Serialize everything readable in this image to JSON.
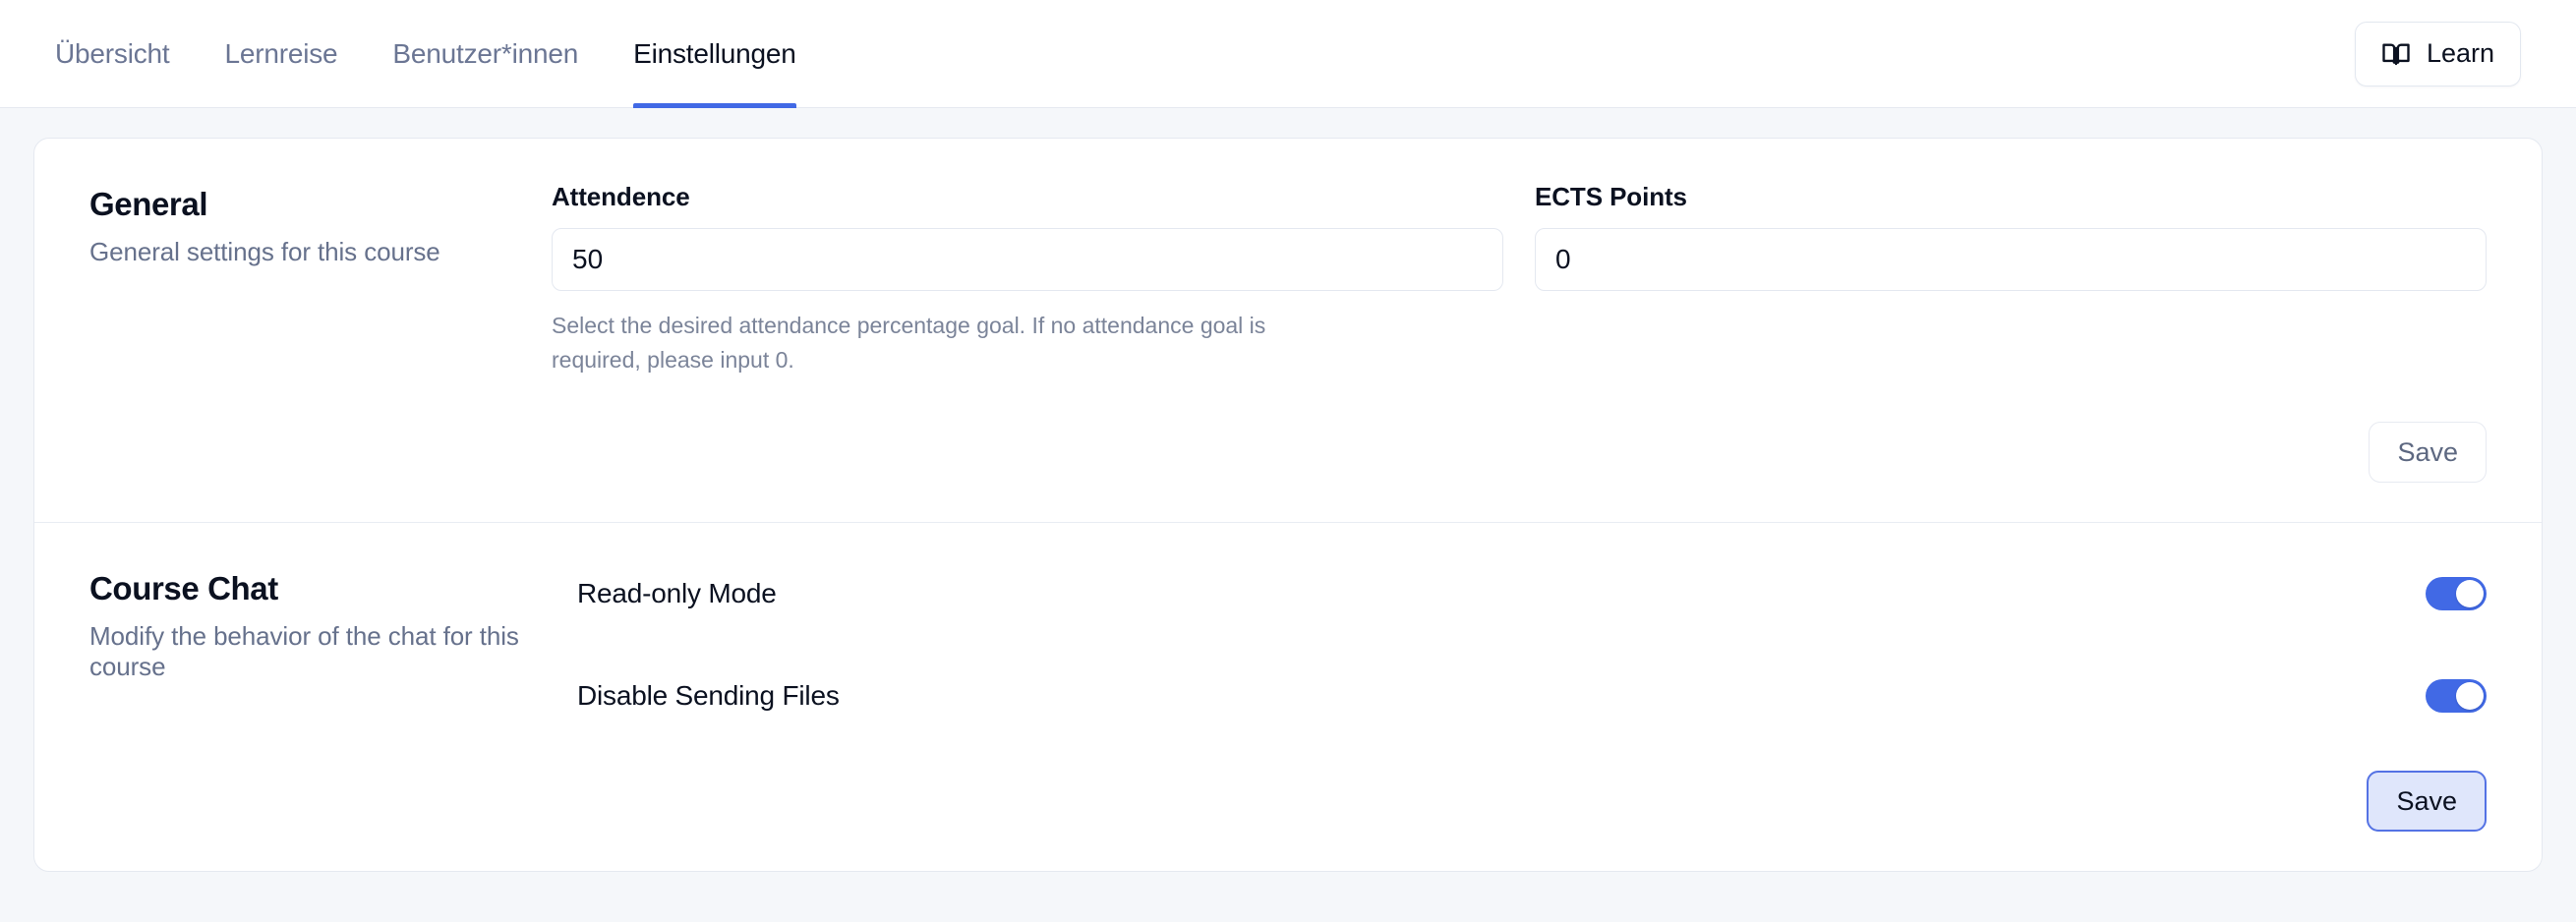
{
  "header": {
    "tabs": [
      {
        "label": "Übersicht",
        "active": false
      },
      {
        "label": "Lernreise",
        "active": false
      },
      {
        "label": "Benutzer*innen",
        "active": false
      },
      {
        "label": "Einstellungen",
        "active": true
      }
    ],
    "learn_button": {
      "label": "Learn",
      "icon": "open-book-icon"
    }
  },
  "sections": {
    "general": {
      "title": "General",
      "description": "General settings for this course",
      "fields": {
        "attendence": {
          "label": "Attendence",
          "value": "50",
          "help": "Select the desired attendance percentage goal. If no attendance goal is required, please input 0."
        },
        "ects": {
          "label": "ECTS Points",
          "value": "0"
        }
      },
      "save_label": "Save"
    },
    "course_chat": {
      "title": "Course Chat",
      "description": "Modify the behavior of the chat for this course",
      "toggles": [
        {
          "label": "Read-only Mode",
          "on": true
        },
        {
          "label": "Disable Sending Files",
          "on": true
        }
      ],
      "save_label": "Save"
    }
  },
  "colors": {
    "accent": "#4169e5",
    "page_background": "#f5f7fa",
    "card_background": "#ffffff",
    "text_primary": "#0b1120",
    "text_muted": "#66718c",
    "focused_button_fill": "#dfe6fb"
  }
}
